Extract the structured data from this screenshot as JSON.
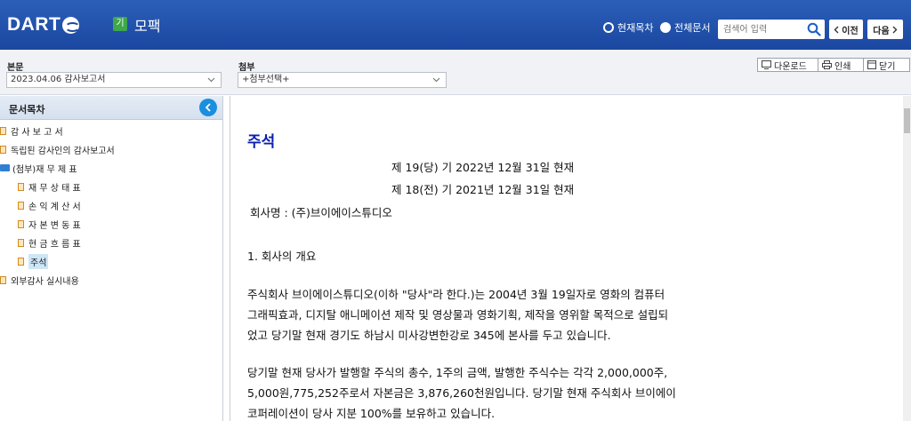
{
  "header": {
    "logo": "DART",
    "doc_badge": "기",
    "doc_title": "모팩",
    "radio_current": "현재목차",
    "radio_all": "전체문서",
    "search_placeholder": "검색어 입력",
    "prev_label": "이전",
    "next_label": "다음"
  },
  "toolbar": {
    "main_label": "본문",
    "main_value": "2023.04.06  감사보고서",
    "attach_label": "첨부",
    "attach_value": "+첨부선택+",
    "download_label": "다운로드",
    "print_label": "인쇄",
    "close_label": "닫기"
  },
  "sidebar": {
    "title": "문서목차",
    "items": [
      {
        "label": "감 사 보 고 서",
        "level": 0
      },
      {
        "label": "독립된 감사인의 감사보고서",
        "level": 0
      },
      {
        "label": "(첨부)재 무 제 표",
        "level": 0,
        "folder": true
      },
      {
        "label": "재 무 상 태 표",
        "level": 1
      },
      {
        "label": "손 익 계 산 서",
        "level": 1
      },
      {
        "label": "자 본 변 동 표",
        "level": 1
      },
      {
        "label": "현 금 흐 름 표",
        "level": 1
      },
      {
        "label": "주석",
        "level": 1,
        "selected": true
      },
      {
        "label": "외부감사 실시내용",
        "level": 0
      }
    ]
  },
  "content": {
    "section_title": "주석",
    "period_current": "제 19(당) 기 2022년 12월 31일 현재",
    "period_prior": "제 18(전) 기 2021년 12월 31일 현재",
    "company": "회사명 : (주)브이에이스튜디오",
    "heading_1": "1. 회사의 개요",
    "para1": [
      "주식회사 브이에이스튜디오(이하 \"당사\"라 한다.)는 2004년 3월 19일자로 영화의 컴퓨터",
      "그래픽효과, 디지탈 애니메이션 제작 및 영상물과 영화기획, 제작을 영위할 목적으로 설립되",
      "었고 당기말 현재 경기도 하남시 미사강변한강로 345에 본사를 두고 있습니다."
    ],
    "para2": [
      "당기말 현재 당사가 발행할 주식의 총수, 1주의 금액, 발행한 주식수는 각각 2,000,000주,",
      "5,000원,775,252주로서 자본금은 3,876,260천원입니다. 당기말 현재 주식회사 브이에이",
      "코퍼레이션이 당사 지분 100%를 보유하고 있습니다."
    ]
  }
}
